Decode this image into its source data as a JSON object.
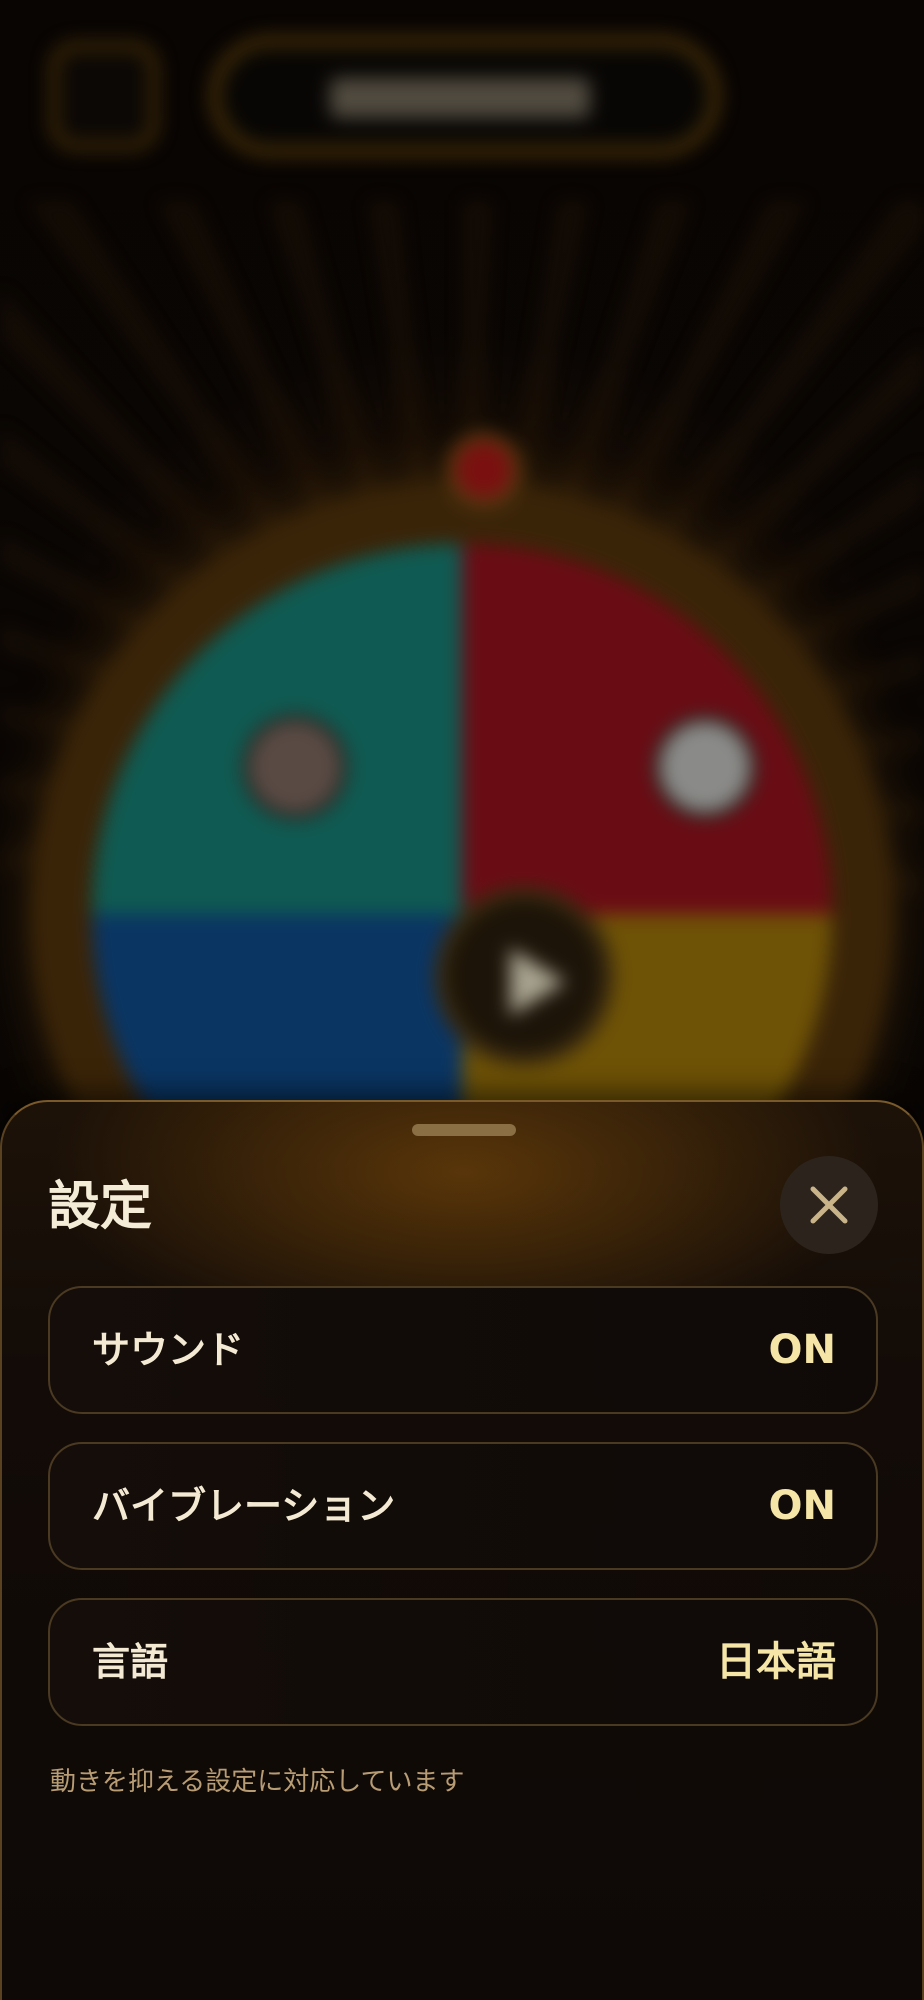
{
  "settings_sheet": {
    "title": "設定",
    "close_icon": "close-icon",
    "rows": [
      {
        "label": "サウンド",
        "value": "ON"
      },
      {
        "label": "バイブレーション",
        "value": "ON"
      },
      {
        "label": "言語",
        "value": "日本語"
      }
    ],
    "note": "動きを抑える設定に対応しています"
  },
  "colors": {
    "accent_gold": "#f5e6a8",
    "sheet_border": "#7a5a2a",
    "wheel_segments": [
      "#6a0c14",
      "#6e5206",
      "#0a3563",
      "#0f5a52"
    ]
  }
}
